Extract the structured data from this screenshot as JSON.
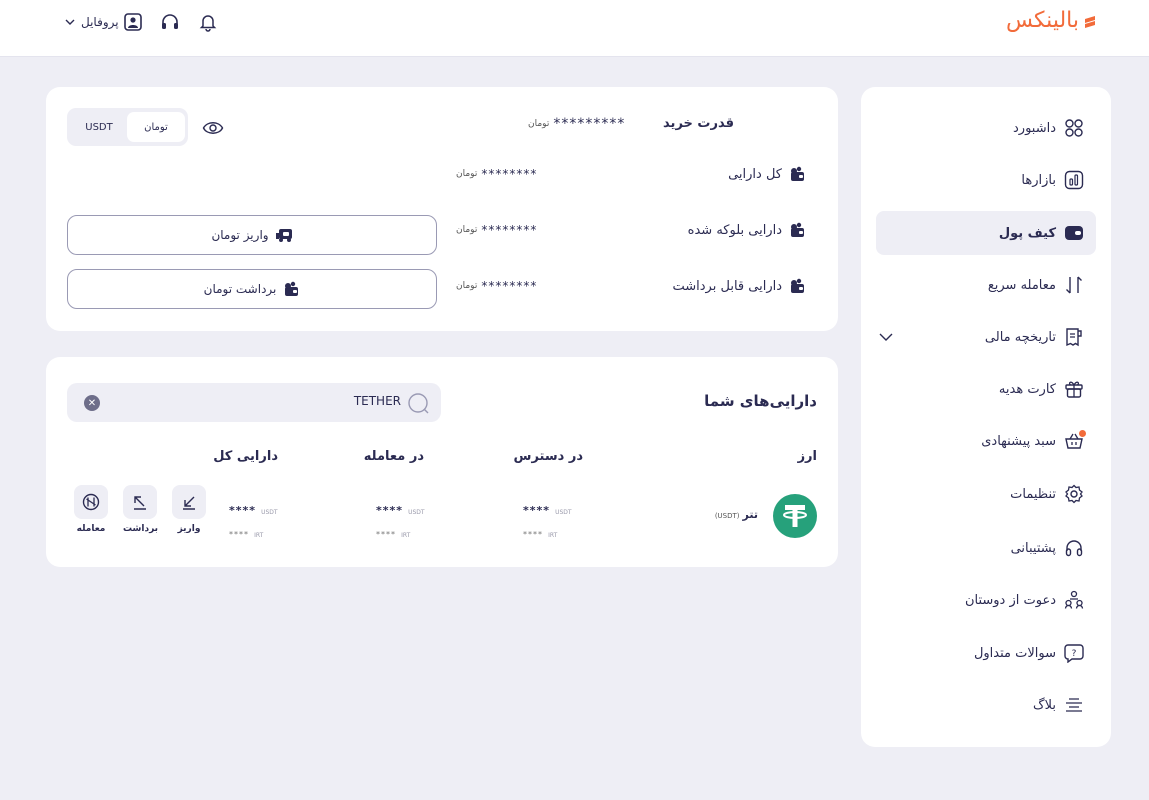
{
  "header": {
    "logo_text": "بالینکس",
    "profile_label": "پروفایل"
  },
  "sidebar": {
    "items": [
      {
        "label": "داشبورد",
        "icon": "dashboard-icon"
      },
      {
        "label": "بازارها",
        "icon": "markets-icon"
      },
      {
        "label": "کیف پول",
        "icon": "wallet-icon",
        "active": true
      },
      {
        "label": "معامله سریع",
        "icon": "swap-icon"
      },
      {
        "label": "تاریخچه مالی",
        "icon": "receipt-icon"
      },
      {
        "label": "کارت هدیه",
        "icon": "gift-icon"
      },
      {
        "label": "سبد پیشنهادی",
        "icon": "basket-icon"
      },
      {
        "label": "تنظیمات",
        "icon": "gear-icon"
      },
      {
        "label": "پشتیبانی",
        "icon": "headset-icon"
      },
      {
        "label": "دعوت از دوستان",
        "icon": "users-icon"
      },
      {
        "label": "سوالات متداول",
        "icon": "faq-icon"
      },
      {
        "label": "بلاگ",
        "icon": "menu-lines-icon"
      }
    ]
  },
  "wallet": {
    "buying_power_label": "قدرت خرید",
    "buying_power_value": "*********",
    "total_assets_label": "کل دارایی",
    "total_assets_value": "********",
    "blocked_assets_label": "دارایی بلوکه شده",
    "blocked_assets_value": "********",
    "withdrawable_assets_label": "دارایی قابل برداشت",
    "withdrawable_assets_value": "********",
    "currency_unit": "تومان",
    "toggle_options": [
      "تومان",
      "USDT"
    ],
    "deposit_button": "واریز تومان",
    "withdraw_button": "برداشت تومان"
  },
  "assets": {
    "title": "دارایی‌های شما",
    "search_value": "TETHER",
    "columns": [
      "ارز",
      "در دسترس",
      "در معامله",
      "دارایی کل"
    ],
    "rows": [
      {
        "name": "تتر",
        "symbol": "(USDT)",
        "available_main": "****",
        "available_sub": "****",
        "in_trade_main": "****",
        "in_trade_sub": "****",
        "total_main": "****",
        "total_sub": "****",
        "unit_main": "USDT",
        "unit_sub": "IRT"
      }
    ],
    "actions": [
      "واریز",
      "برداشت",
      "معامله"
    ]
  },
  "colors": {
    "accent": "#f26b3a",
    "primary": "#2b2b52",
    "tether": "#26a17b"
  }
}
